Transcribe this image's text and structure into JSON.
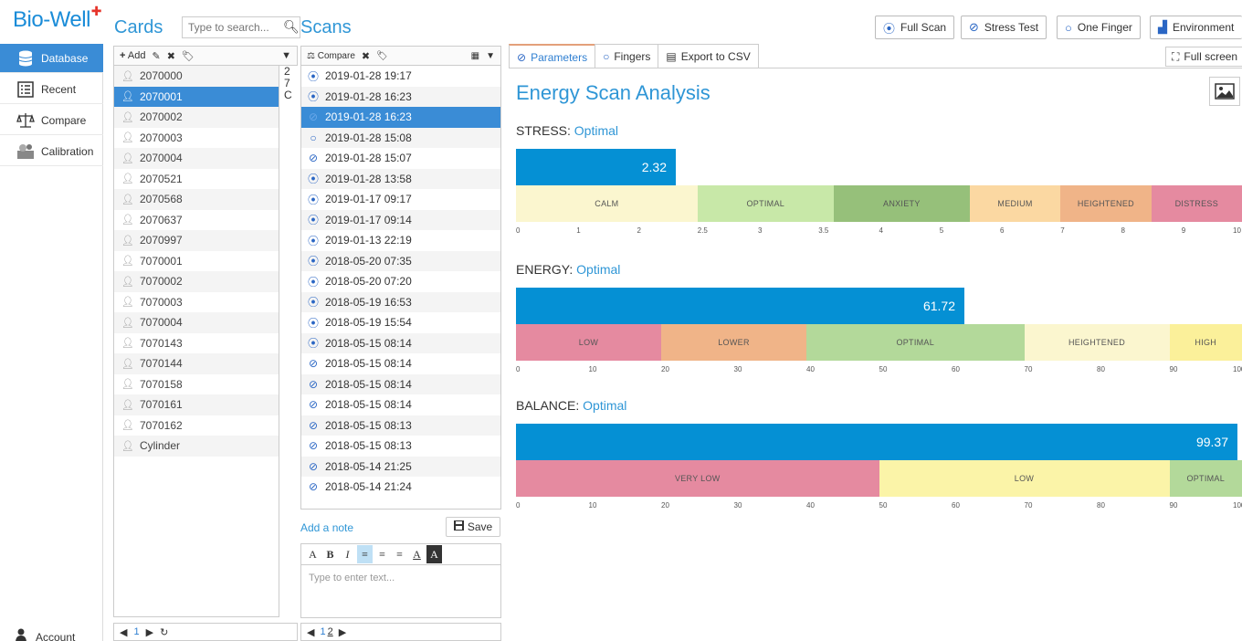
{
  "app": {
    "logo": "Bio-Well"
  },
  "nav": {
    "items": [
      {
        "label": "Database",
        "icon": "database-icon",
        "active": true
      },
      {
        "label": "Recent",
        "icon": "list-icon"
      },
      {
        "label": "Compare",
        "icon": "scales-icon"
      },
      {
        "label": "Calibration",
        "icon": "calibration-icon"
      }
    ],
    "account": "Account"
  },
  "cards": {
    "title": "Cards",
    "search_placeholder": "Type to search...",
    "add_label": "Add",
    "items": [
      "2070000",
      "2070001",
      "2070002",
      "2070003",
      "2070004",
      "2070521",
      "2070568",
      "2070637",
      "2070997",
      "7070001",
      "7070002",
      "7070003",
      "7070004",
      "7070143",
      "7070144",
      "7070158",
      "7070161",
      "7070162",
      "Cylinder"
    ],
    "selected_index": 1,
    "side_digits": [
      "2",
      "7",
      "C"
    ],
    "page": "1"
  },
  "scans": {
    "title": "Scans",
    "compare_label": "Compare",
    "items": [
      {
        "date": "2019-01-28 19:17",
        "type": "finger-scan"
      },
      {
        "date": "2019-01-28 16:23",
        "type": "finger-scan"
      },
      {
        "date": "2019-01-28 16:23",
        "type": "stress"
      },
      {
        "date": "2019-01-28 15:08",
        "type": "one-finger"
      },
      {
        "date": "2019-01-28 15:07",
        "type": "stress"
      },
      {
        "date": "2019-01-28 13:58",
        "type": "finger-scan"
      },
      {
        "date": "2019-01-17 09:17",
        "type": "finger-scan"
      },
      {
        "date": "2019-01-17 09:14",
        "type": "finger-scan"
      },
      {
        "date": "2019-01-13 22:19",
        "type": "finger-scan"
      },
      {
        "date": "2018-05-20 07:35",
        "type": "finger-scan"
      },
      {
        "date": "2018-05-20 07:20",
        "type": "finger-scan"
      },
      {
        "date": "2018-05-19 16:53",
        "type": "finger-scan"
      },
      {
        "date": "2018-05-19 15:54",
        "type": "finger-scan"
      },
      {
        "date": "2018-05-15 08:14",
        "type": "finger-scan"
      },
      {
        "date": "2018-05-15 08:14",
        "type": "stress"
      },
      {
        "date": "2018-05-15 08:14",
        "type": "stress"
      },
      {
        "date": "2018-05-15 08:14",
        "type": "stress"
      },
      {
        "date": "2018-05-15 08:13",
        "type": "stress"
      },
      {
        "date": "2018-05-15 08:13",
        "type": "stress"
      },
      {
        "date": "2018-05-14 21:25",
        "type": "stress"
      },
      {
        "date": "2018-05-14 21:24",
        "type": "stress"
      }
    ],
    "selected_index": 2,
    "add_note": "Add a note",
    "save_label": "Save",
    "note_placeholder": "Type to enter text...",
    "pages": [
      "1",
      "2"
    ]
  },
  "topbar": {
    "full_scan": "Full Scan",
    "stress_test": "Stress Test",
    "one_finger": "One Finger",
    "environment": "Environment"
  },
  "tabs": [
    {
      "label": "Parameters",
      "active": true
    },
    {
      "label": "Fingers"
    },
    {
      "label": "Export to CSV"
    }
  ],
  "fullscreen_label": "Full screen",
  "analysis": {
    "title": "Energy Scan Analysis",
    "sections": [
      {
        "name": "STRESS:",
        "status": "Optimal",
        "value": "2.32",
        "value_num": 2.32,
        "segments": [
          {
            "label": "CALM",
            "color": "#fbf6cf",
            "span": 2
          },
          {
            "label": "OPTIMAL",
            "color": "#c8e8a8",
            "span": 1.5
          },
          {
            "label": "ANXIETY",
            "color": "#96c07a",
            "span": 1.5
          },
          {
            "label": "MEDIUM",
            "color": "#fbd8a2",
            "span": 1
          },
          {
            "label": "HEIGHTENED",
            "color": "#f0b488",
            "span": 1
          },
          {
            "label": "DISTRESS",
            "color": "#e58aa0",
            "span": 1
          }
        ],
        "ticks": [
          "0",
          "1",
          "2",
          "2.5",
          "3",
          "3.5",
          "4",
          "5",
          "6",
          "7",
          "8",
          "9",
          "10"
        ]
      },
      {
        "name": "ENERGY:",
        "status": "Optimal",
        "value": "61.72",
        "value_num": 61.72,
        "segments": [
          {
            "label": "LOW",
            "color": "#e58aa0",
            "span": 20
          },
          {
            "label": "LOWER",
            "color": "#f0b488",
            "span": 20
          },
          {
            "label": "OPTIMAL",
            "color": "#b3d99a",
            "span": 30
          },
          {
            "label": "HEIGHTENED",
            "color": "#fbf6cf",
            "span": 20
          },
          {
            "label": "HIGH",
            "color": "#fbf09a",
            "span": 10
          }
        ],
        "ticks": [
          "0",
          "10",
          "20",
          "30",
          "40",
          "50",
          "60",
          "70",
          "80",
          "90",
          "100"
        ]
      },
      {
        "name": "BALANCE:",
        "status": "Optimal",
        "value": "99.37",
        "value_num": 99.37,
        "segments": [
          {
            "label": "VERY LOW",
            "color": "#e58aa0",
            "span": 50
          },
          {
            "label": "LOW",
            "color": "#fbf4a8",
            "span": 40
          },
          {
            "label": "OPTIMAL",
            "color": "#b3d99a",
            "span": 10
          }
        ],
        "ticks": [
          "0",
          "10",
          "20",
          "30",
          "40",
          "50",
          "60",
          "70",
          "80",
          "90",
          "100"
        ]
      }
    ]
  }
}
